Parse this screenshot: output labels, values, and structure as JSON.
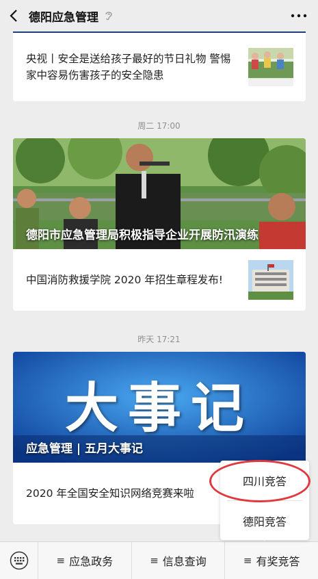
{
  "header": {
    "title": "德阳应急管理"
  },
  "feed": {
    "card1": {
      "headline": "央视丨安全是送给孩子最好的节日礼物 警惕家中容易伤害孩子的安全隐患"
    },
    "group2": {
      "time": "周二 17:00",
      "banner_caption": "德阳市应急管理局积极指导企业开展防汛演练",
      "item_text": "中国消防救援学院 2020 年招生章程发布!"
    },
    "group3": {
      "time": "昨天 17:21",
      "banner_big_text": "大事记",
      "banner_caption": "应急管理 | 五月大事记",
      "item_text": "2020 年全国安全知识网络竞赛来啦"
    }
  },
  "popup_menu": {
    "items": [
      "四川竞答",
      "德阳竞答"
    ]
  },
  "bottom_menu": {
    "items": [
      "应急政务",
      "信息查询",
      "有奖竞答"
    ]
  },
  "colors": {
    "background": "#ededed",
    "highlight_circle": "#e0383e",
    "banner_blue": "#1f6fd0"
  }
}
